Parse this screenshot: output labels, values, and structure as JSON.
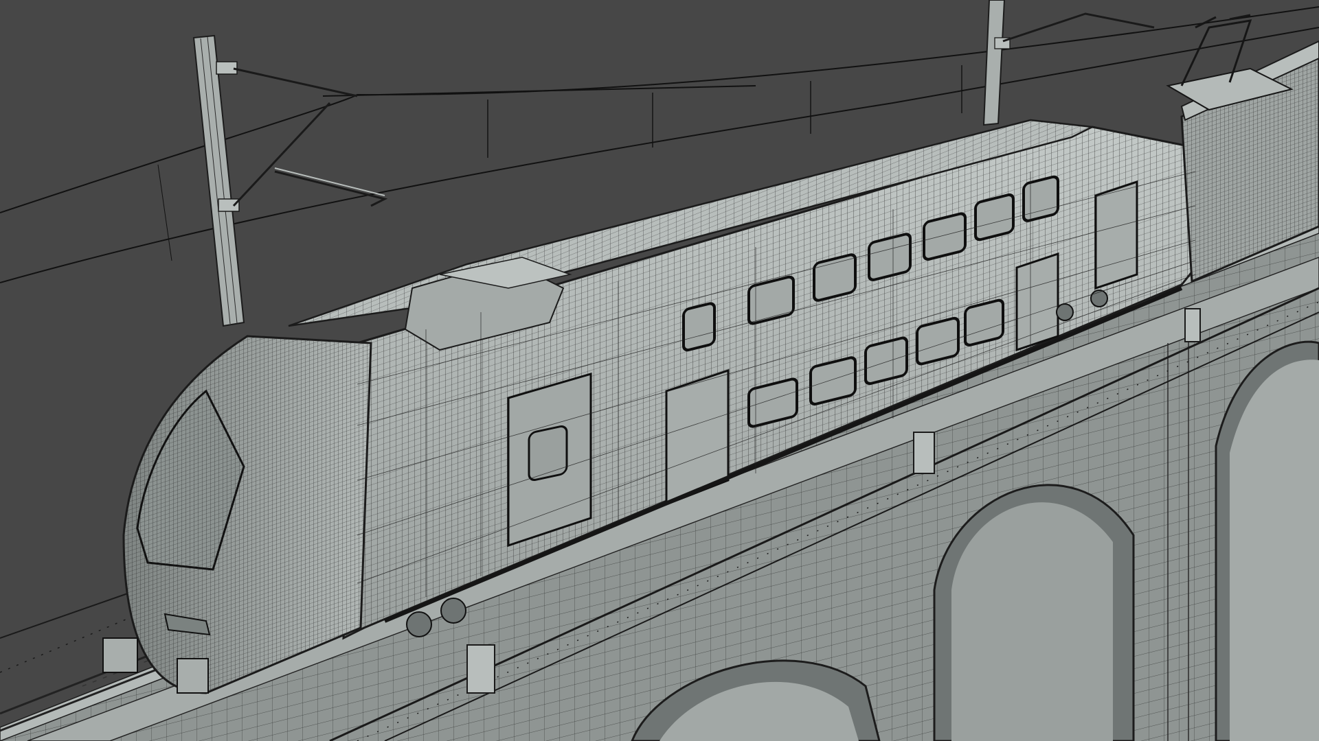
{
  "viewport": {
    "background_color": "#474747",
    "render_style": "wireframe-on-shaded",
    "shaded_color": "#9da3a1",
    "shaded_highlight_color": "#c5cbc9",
    "wire_color": "#1e1e1e",
    "glass_color": "#8e9593"
  },
  "scene": {
    "subjects": [
      {
        "name": "double-deck-electric-train",
        "icon": "train-icon"
      },
      {
        "name": "pantograph",
        "icon": "pantograph-icon"
      },
      {
        "name": "overhead-catenary-line",
        "icon": "cable-icon"
      },
      {
        "name": "catenary-mast",
        "icon": "pole-icon"
      },
      {
        "name": "stone-arch-viaduct",
        "icon": "bridge-icon"
      },
      {
        "name": "railway-track",
        "icon": "track-icon"
      },
      {
        "name": "bridge-railing",
        "icon": "fence-icon"
      }
    ]
  }
}
